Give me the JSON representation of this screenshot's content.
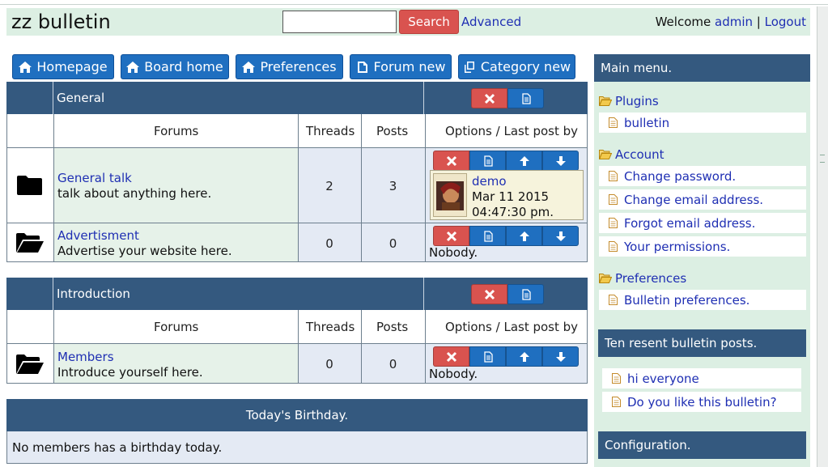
{
  "header": {
    "site_title": "zz bulletin",
    "search_placeholder": "",
    "search_button": "Search",
    "advanced_link": "Advanced",
    "welcome_prefix": "Welcome",
    "username": "admin",
    "separator": "|",
    "logout": "Logout"
  },
  "nav": {
    "homepage": "Homepage",
    "board_home": "Board home",
    "preferences": "Preferences",
    "forum_new": "Forum new",
    "category_new": "Category new"
  },
  "columns": {
    "forums": "Forums",
    "threads": "Threads",
    "posts": "Posts",
    "options": "Options / Last post by"
  },
  "categories": [
    {
      "name": "General",
      "forums": [
        {
          "name": "General talk",
          "description": "talk about anything here.",
          "threads": "2",
          "posts": "3",
          "last_post": {
            "user": "demo",
            "date": "Mar 11 2015",
            "time": "04:47:30 pm."
          }
        },
        {
          "name": "Advertisment",
          "description": "Advertise your website here.",
          "threads": "0",
          "posts": "0",
          "last_post_text": "Nobody."
        }
      ]
    },
    {
      "name": "Introduction",
      "forums": [
        {
          "name": "Members",
          "description": "Introduce yourself here.",
          "threads": "0",
          "posts": "0",
          "last_post_text": "Nobody."
        }
      ]
    }
  ],
  "birthday": {
    "title": "Today's Birthday.",
    "message": "No members has a birthday today."
  },
  "sidebar": {
    "main_menu_title": "Main menu.",
    "groups": [
      {
        "label": "Plugins",
        "items": [
          "bulletin"
        ]
      },
      {
        "label": "Account",
        "items": [
          "Change password.",
          "Change email address.",
          "Forgot email address.",
          "Your permissions."
        ]
      },
      {
        "label": "Preferences",
        "items": [
          "Bulletin preferences."
        ]
      }
    ],
    "recent_title": "Ten resent bulletin posts.",
    "recent_posts": [
      "hi everyone",
      "Do you like this bulletin?"
    ],
    "config_title": "Configuration."
  },
  "colors": {
    "header_bg": "#dcefe3",
    "table_head_bg": "#34597f",
    "button_blue": "#1f6fc0",
    "button_red": "#d9534f",
    "link": "#1f2fb3"
  }
}
